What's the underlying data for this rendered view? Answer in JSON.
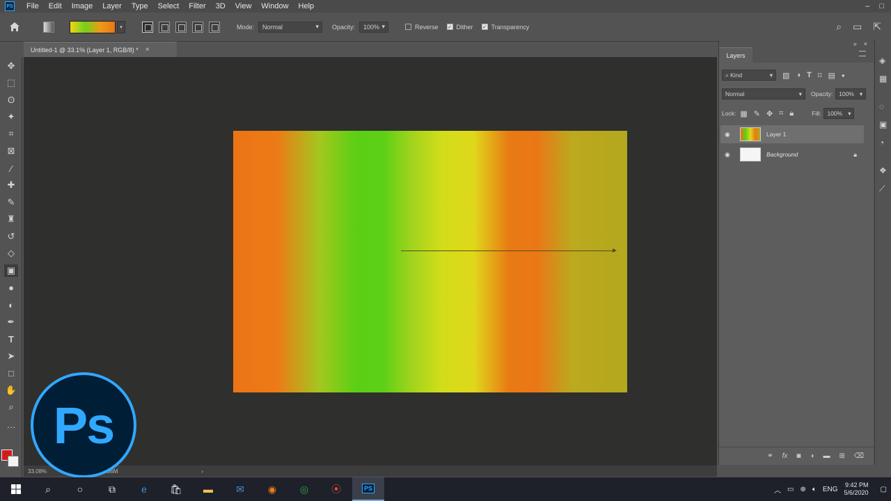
{
  "menu": {
    "app_icon": "PS",
    "items": [
      "File",
      "Edit",
      "Image",
      "Layer",
      "Type",
      "Select",
      "Filter",
      "3D",
      "View",
      "Window",
      "Help"
    ],
    "window_controls": [
      "–",
      "□"
    ]
  },
  "options_bar": {
    "mode_label": "Mode:",
    "mode_value": "Normal",
    "opacity_label": "Opacity:",
    "opacity_value": "100%",
    "reverse_label": "Reverse",
    "reverse_checked": false,
    "dither_label": "Dither",
    "dither_checked": true,
    "transparency_label": "Transparency",
    "transparency_checked": true,
    "gradient_colors": [
      "#f2d31a",
      "#74d01a",
      "#ee9a18",
      "#e9761a"
    ]
  },
  "document_tab": {
    "title": "Untitled-1 @ 33.1% (Layer 1, RGB/8) *",
    "close": "×"
  },
  "status_bar": {
    "zoom": "33.08%",
    "doc_size": "/18M/8.56M",
    "arrow": "›"
  },
  "layers_panel": {
    "tab_label": "Layers",
    "filter_label": "Kind",
    "blend_mode": "Normal",
    "opacity_label": "Opacity:",
    "opacity_value": "100%",
    "lock_label": "Lock:",
    "fill_label": "Fill:",
    "fill_value": "100%",
    "layers": [
      {
        "name": "Layer 1",
        "visible": true,
        "selected": true
      },
      {
        "name": "Background",
        "visible": true,
        "selected": false,
        "locked": true
      }
    ]
  },
  "colors": {
    "foreground": "#d21b1b",
    "background": "#f3f3f3",
    "ps_blue": "#31a8ff"
  },
  "logo": {
    "text": "Ps"
  },
  "taskbar": {
    "language": "ENG",
    "time": "9:42 PM",
    "date": "5/6/2020"
  }
}
